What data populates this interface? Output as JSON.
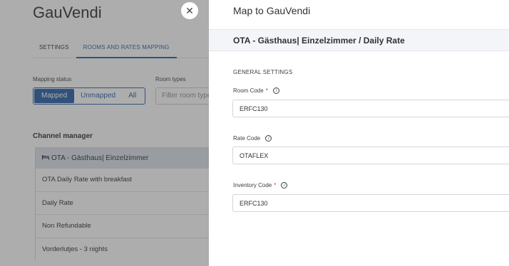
{
  "app": {
    "title": "GauVendi"
  },
  "tabs": [
    {
      "label": "SETTINGS"
    },
    {
      "label": "ROOMS AND RATES MAPPING"
    }
  ],
  "filters": {
    "mapping_status_label": "Mapping status",
    "segments": [
      "Mapped",
      "Unmapped",
      "All"
    ],
    "selected": "Mapped",
    "room_types_label": "Room types",
    "room_types_placeholder": "Filter room types"
  },
  "channel_manager": {
    "heading": "Channel manager",
    "group_label": "OTA - Gästhaus| Einzelzimmer",
    "rows": [
      "OTA Daily Rate with breakfast",
      "Daily Rate",
      "Non Refundable",
      "Vorderlutjes - 3 nights"
    ]
  },
  "drawer": {
    "title": "Map to GauVendi",
    "subtitle": "OTA - Gästhaus| Einzelzimmer / Daily Rate",
    "section": "GENERAL SETTINGS",
    "fields": {
      "room_code": {
        "label": "Room Code",
        "required": "*",
        "value": "ERFC130"
      },
      "rate_code": {
        "label": "Rate Code",
        "value": "OTAFLEX"
      },
      "inventory_code": {
        "label": "Inventory Code",
        "required": "*",
        "value": "ERFC130"
      }
    }
  },
  "colors": {
    "accent": "#2962a8",
    "overlay": "rgba(60,60,60,0.42)"
  },
  "icons": {
    "close": "close-icon",
    "bed": "bed-icon",
    "info": "info-icon"
  }
}
